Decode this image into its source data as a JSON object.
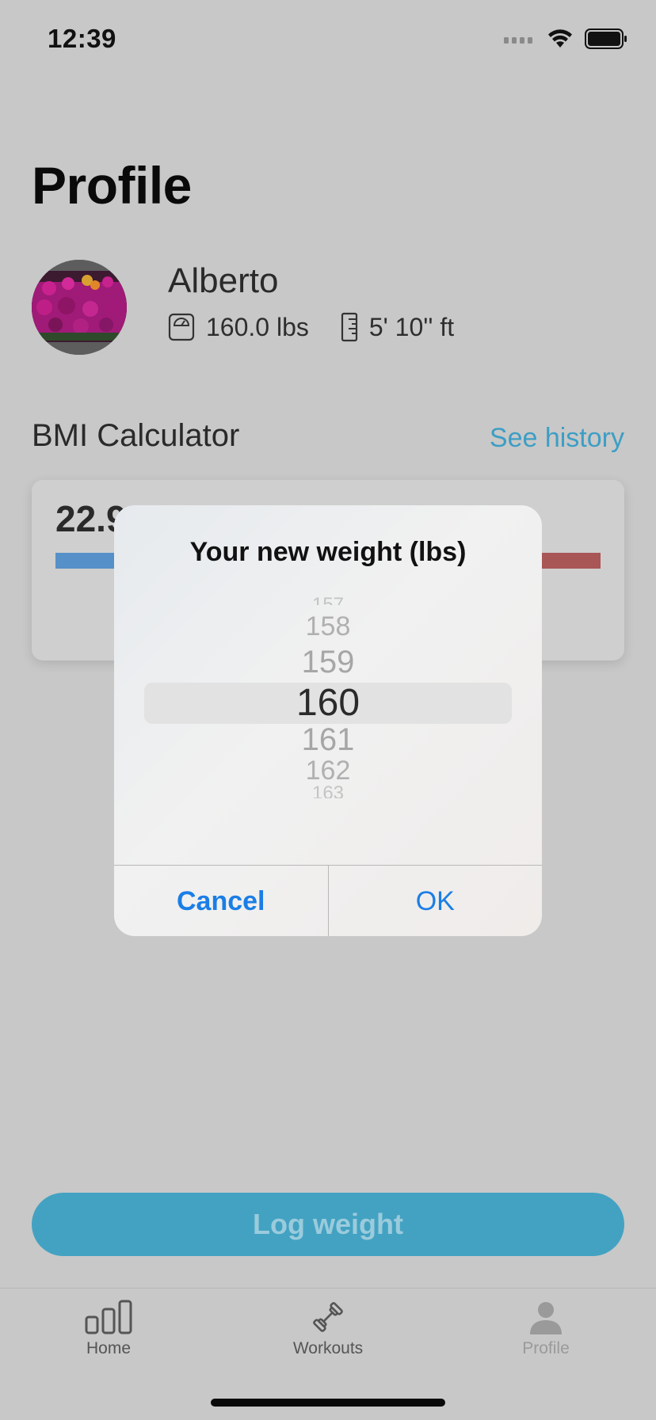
{
  "status_bar": {
    "time": "12:39"
  },
  "page": {
    "title": "Profile"
  },
  "profile": {
    "name": "Alberto",
    "weight": "160.0 lbs",
    "height": "5' 10'' ft"
  },
  "bmi": {
    "section_title": "BMI Calculator",
    "history_link": "See history",
    "value": "22.9",
    "colors": {
      "underweight": "#5690c8",
      "overweight": "#a85656"
    }
  },
  "dialog": {
    "title": "Your new weight (lbs)",
    "picker": {
      "items": [
        "157",
        "158",
        "159",
        "160",
        "161",
        "162",
        "163"
      ],
      "selected": "160"
    },
    "cancel_label": "Cancel",
    "ok_label": "OK"
  },
  "log_weight_label": "Log weight",
  "tabs": [
    {
      "label": "Home",
      "icon": "bar-chart-icon"
    },
    {
      "label": "Workouts",
      "icon": "dumbbell-icon"
    },
    {
      "label": "Profile",
      "icon": "person-icon"
    }
  ],
  "colors": {
    "accent": "#43a2c2",
    "link": "#3d9ec4",
    "dialog_button": "#1a7ee6"
  }
}
